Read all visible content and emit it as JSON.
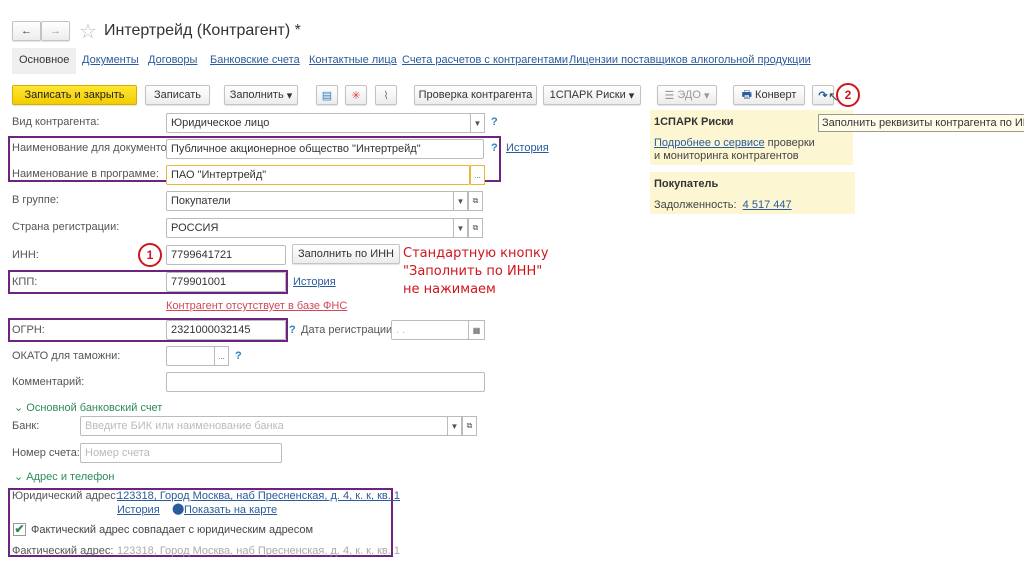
{
  "header": {
    "title": "Интертрейд (Контрагент) *",
    "back": "←",
    "forward": "→",
    "star": "☆"
  },
  "tabs": [
    "Основное",
    "Документы",
    "Договоры",
    "Банковские счета",
    "Контактные лица",
    "Счета расчетов с контрагентами",
    "Лицензии поставщиков алкогольной продукции"
  ],
  "toolbar": {
    "save_close": "Записать и закрыть",
    "save": "Записать",
    "fill": "Заполнить",
    "check": "Проверка контрагента",
    "spark": "1СПАРК Риски",
    "edo": "ЭДО",
    "envelope": "Конверт",
    "dropdown_caret": "▾"
  },
  "tooltip": "Заполнить реквизиты контрагента по ИНН",
  "spark_panel": {
    "title": "1СПАРК Риски",
    "link": "Подробнее о сервисе",
    "text1": " проверки",
    "text2": "и мониторинга контрагентов"
  },
  "buyer_panel": {
    "title": "Покупатель",
    "debt_label": "Задолженность:",
    "debt_value": "4 517 447"
  },
  "form": {
    "kind_label": "Вид контрагента:",
    "kind_value": "Юридическое лицо",
    "docname_label": "Наименование для документов:",
    "docname_value": "Публичное акционерное общество \"Интертрейд\"",
    "progname_label": "Наименование в программе:",
    "progname_value": "ПАО \"Интертрейд\"",
    "history": "История",
    "question": "?",
    "ellipsis": "...",
    "group_label": "В группе:",
    "group_value": "Покупатели",
    "country_label": "Страна регистрации:",
    "country_value": "РОССИЯ",
    "inn_label": "ИНН:",
    "inn_value": "7799641721",
    "fill_inn": "Заполнить по ИНН",
    "kpp_label": "КПП:",
    "kpp_value": "779901001",
    "fns_warning": "Контрагент отсутствует в базе ФНС",
    "ogrn_label": "ОГРН:",
    "ogrn_value": "2321000032145",
    "regdate_label": "Дата регистрации:",
    "regdate_value": " .  .",
    "okato_label": "ОКАТО для таможни:",
    "comment_label": "Комментарий:"
  },
  "bank": {
    "section": "Основной банковский счет",
    "bank_label": "Банк:",
    "bank_placeholder": "Введите БИК или наименование банка",
    "account_label": "Номер счета:",
    "account_placeholder": "Номер счета"
  },
  "address": {
    "section": "Адрес и телефон",
    "legal_label": "Юридический адрес:",
    "legal_value": "123318, Город Москва, наб Пресненская, д. 4, к. к, кв. 1",
    "history": "История",
    "map": "Показать на карте",
    "same_checkbox": "Фактический адрес совпадает с юридическим адресом",
    "same_checked": true,
    "actual_label": "Фактический адрес:",
    "actual_value": "123318, Город Москва, наб Пресненская, д. 4, к. к, кв. 1"
  },
  "annotations": {
    "marker1": "1",
    "marker2": "2",
    "note_line1": "Стандартную кнопку",
    "note_line2": "\"Заполнить по ИНН\"",
    "note_line3": "не нажимаем",
    "note_color": "#d0141b",
    "highlight_color": "#6b2580"
  }
}
